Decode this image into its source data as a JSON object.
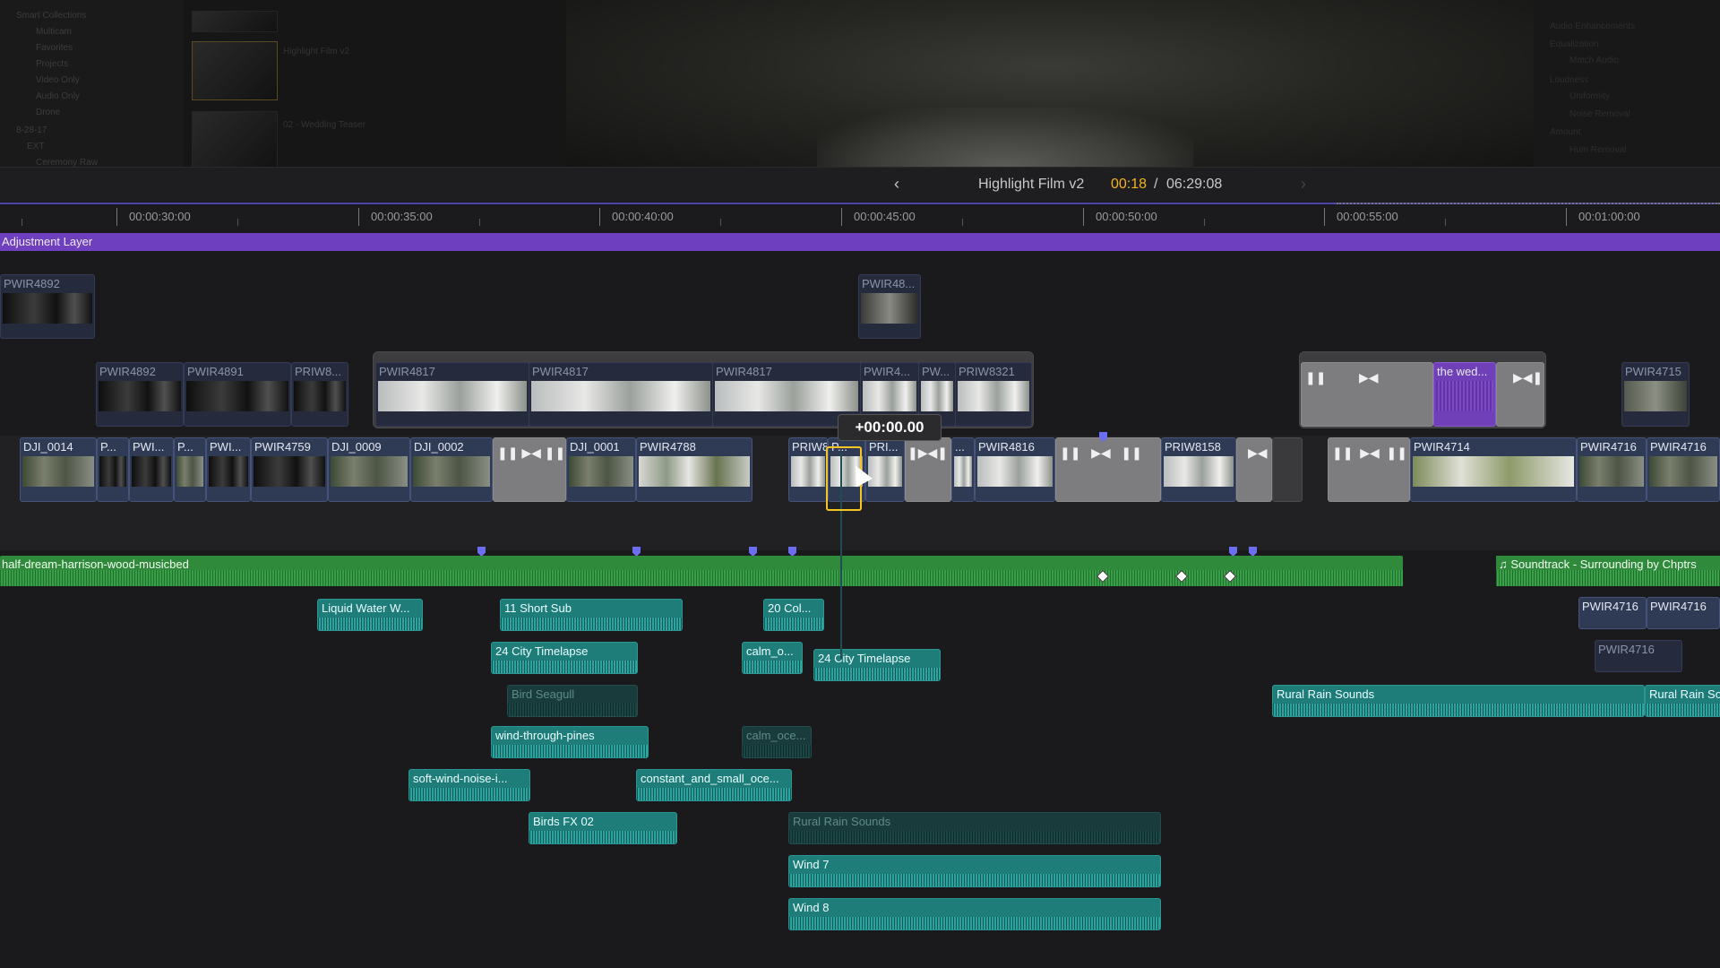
{
  "top": {
    "browser_items": [
      "Smart Collections",
      "Multicam",
      "Favorites",
      "Projects",
      "Video Only",
      "Audio Only",
      "Drone",
      "8-28-17",
      "EXT",
      "Ceremony Raw"
    ],
    "thumb_labels": [
      "Highlight Film v2",
      "02 - Wedding Teaser"
    ],
    "inspector_items": [
      "Audio Enhancements",
      "Equalization",
      "Match Audio",
      "Loudness",
      "Uniformity",
      "Noise Removal",
      "Amount",
      "Hum Removal"
    ]
  },
  "header": {
    "back_icon": "chevron-left-icon",
    "forward_icon": "chevron-right-icon",
    "project_title": "Highlight Film v2",
    "timecode_current": "00:18",
    "timecode_sep": "/",
    "timecode_total": "06:29:08"
  },
  "ruler": {
    "labels": [
      "00:00:30:00",
      "00:00:35:00",
      "00:00:40:00",
      "00:00:45:00",
      "00:00:50:00",
      "00:00:55:00",
      "00:01:00:00"
    ]
  },
  "adjustment_layer": "Adjustment Layer",
  "clips": {
    "upper": [
      "PWIR4892",
      "PWIR48..."
    ],
    "connected": [
      "PWIR4892",
      "PWIR4891",
      "PRIW8...",
      "PWIR4817",
      "PWIR4817",
      "PWIR4817",
      "PWIR4...",
      "PW...",
      "PRIW8321",
      "the wed...",
      "PWIR4715"
    ],
    "primary": [
      "DJI_0014",
      "P...",
      "PWI...",
      "P...",
      "PWI...",
      "PWIR4759",
      "DJI_0009",
      "DJI_0002",
      "DJI_0001",
      "PWIR4788",
      "PRIW8313",
      "P...",
      "PRI...",
      "...",
      "PWIR4816",
      "PRIW8158",
      "PWIR4714",
      "PWIR4716",
      "PWIR4716"
    ]
  },
  "playhead": {
    "offset": "+00:00.00"
  },
  "audio": {
    "music": "half-dream-harrison-wood-musicbed",
    "soundtrack": "Soundtrack - Surrounding by Chptrs",
    "clips": [
      "Liquid Water W...",
      "11 Short Sub",
      "20 Col...",
      "24 City Timelapse",
      "calm_o...",
      "24 City Timelapse",
      "Bird Seagull",
      "wind-through-pines",
      "calm_oce...",
      "soft-wind-noise-i...",
      "constant_and_small_oce...",
      "Birds FX 02",
      "Rural Rain Sounds",
      "Wind 7",
      "Wind 8",
      "Rural Rain Sounds",
      "Rural Rain So",
      "PWIR4716",
      "PWIR4716",
      "PWIR4716"
    ]
  },
  "colors": {
    "accent_timecode": "#f5b31b",
    "adjustment": "#6e3fbf",
    "music": "#2f8a3b",
    "sfx": "#1e7c79",
    "video": "#2f3a55"
  }
}
